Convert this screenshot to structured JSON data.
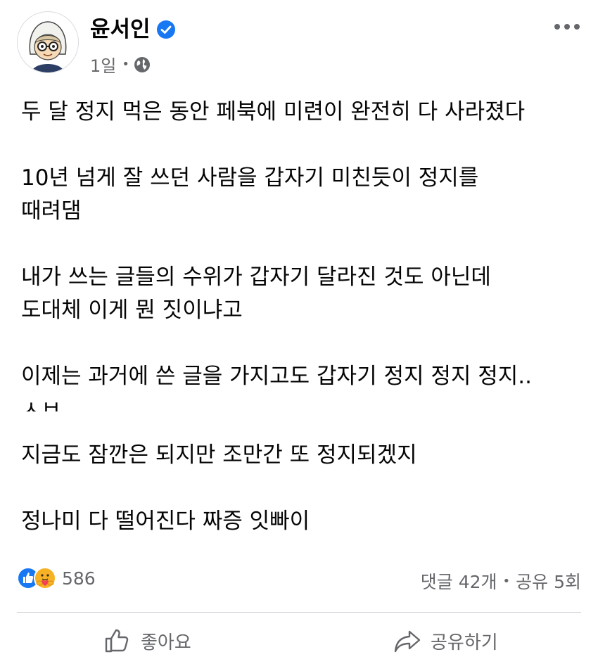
{
  "author": {
    "name": "윤서인",
    "time": "1일",
    "dot": "•"
  },
  "post": {
    "lines": [
      "두 달 정지 먹은 동안 페북에 미련이 완전히 다 사라졌다",
      "10년 넘게 잘 쓰던 사람을 갑자기 미친듯이 정지를",
      "때려댐",
      "내가 쓰는 글들의 수위가 갑자기 달라진 것도 아닌데",
      "도대체 이게 뭔 짓이냐고",
      "이제는 과거에 쓴 글을 가지고도 갑자기 정지 정지 정지..",
      "ㅅㅂ",
      "지금도 잠깐은 되지만 조만간 또 정지되겠지",
      "정나미 다 떨어진다 짜증 잇빠이"
    ]
  },
  "reactions": {
    "count": "586"
  },
  "stats": {
    "comments": "댓글 42개",
    "sep": "•",
    "shares": "공유 5회"
  },
  "actions": {
    "like_label": "좋아요",
    "share_label": "공유하기"
  },
  "colors": {
    "text": "#050505",
    "secondary": "#65676b",
    "brand_blue": "#1877f2",
    "divider": "#ced0d4"
  }
}
